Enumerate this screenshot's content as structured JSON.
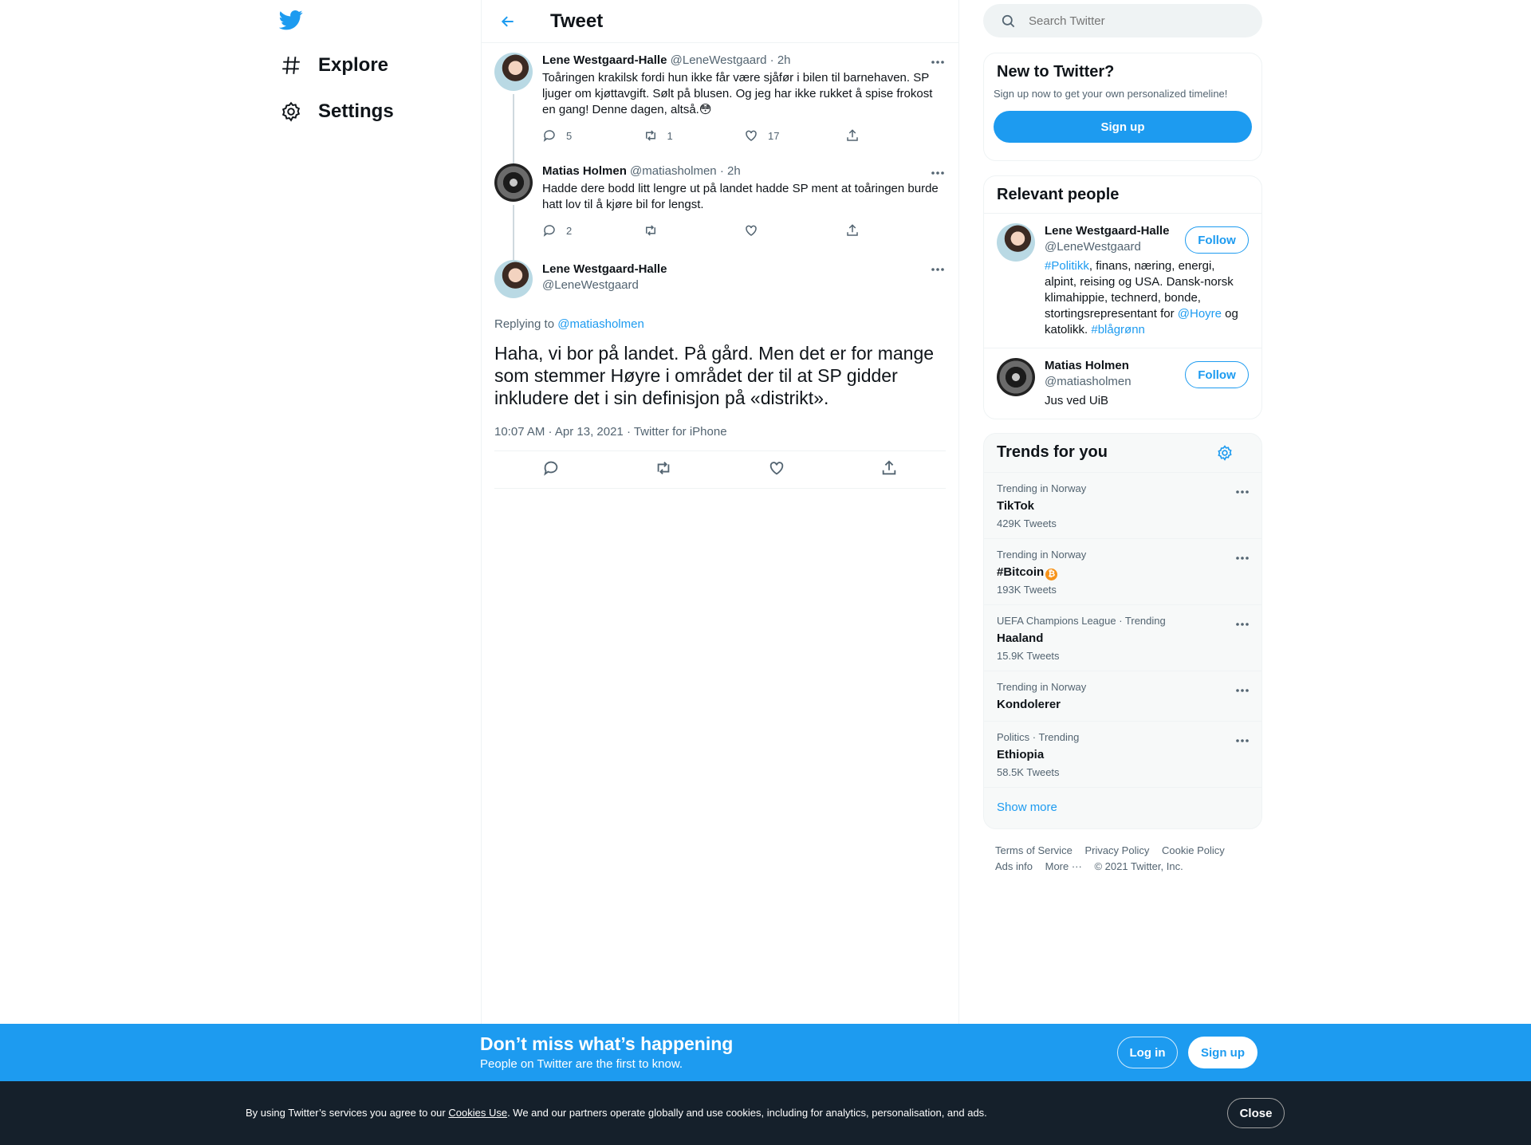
{
  "nav": {
    "explore_label": "Explore",
    "settings_label": "Settings"
  },
  "header": {
    "title": "Tweet"
  },
  "thread": [
    {
      "name": "Lene Westgaard-Halle",
      "handle": "@LeneWestgaard",
      "time": "· 2h",
      "text": "Toåringen krakilsk fordi hun ikke får være sjåfør i bilen til barnehaven. SP ljuger om kjøttavgift. Sølt på blusen. Og jeg har ikke rukket å spise frokost en gang! Denne dagen, altså.😳",
      "replies": "5",
      "retweets": "1",
      "likes": "17"
    },
    {
      "name": "Matias Holmen",
      "handle": "@matiasholmen",
      "time": "· 2h",
      "text": "Hadde dere bodd litt lengre ut på landet hadde SP ment at toåringen burde hatt lov til å kjøre bil for lengst.",
      "replies": "2",
      "retweets": "",
      "likes": ""
    }
  ],
  "focus": {
    "name": "Lene Westgaard-Halle",
    "handle": "@LeneWestgaard",
    "replying_prefix": "Replying to",
    "replying_handle": "@matiasholmen",
    "text": "Haha, vi bor på landet. På gård. Men det er for mange som stemmer Høyre i området der til at SP gidder inkludere det i sin definisjon på «distrikt».",
    "meta": "10:07 AM · Apr 13, 2021 · Twitter for iPhone"
  },
  "search": {
    "placeholder": "Search Twitter"
  },
  "new_to_twitter": {
    "title": "New to Twitter?",
    "subtitle": "Sign up now to get your own personalized timeline!",
    "signup_label": "Sign up"
  },
  "relevant_people": {
    "title": "Relevant people",
    "follow_label": "Follow",
    "people": [
      {
        "name": "Lene Westgaard-Halle",
        "handle": "@LeneWestgaard",
        "bio_tag1": "#Politikk",
        "bio_mid": ", finans, næring, energi, alpint, reising og USA. Dansk-norsk klimahippie, technerd, bonde, stortingsrepresentant for ",
        "bio_tag2": "@Hoyre",
        "bio_mid2": " og katolikk. ",
        "bio_tag3": "#blågrønn"
      },
      {
        "name": "Matias Holmen",
        "handle": "@matiasholmen",
        "bio": "Jus ved UiB"
      }
    ]
  },
  "trends": {
    "title": "Trends for you",
    "items": [
      {
        "context": "Trending in Norway",
        "name": "TikTok",
        "count": "429K Tweets"
      },
      {
        "context": "Trending in Norway",
        "name": "#Bitcoin",
        "emoji": "₿",
        "count": "193K Tweets"
      },
      {
        "context": "UEFA Champions League · Trending",
        "name": "Haaland",
        "count": "15.9K Tweets"
      },
      {
        "context": "Trending in Norway",
        "name": "Kondolerer",
        "count": ""
      },
      {
        "context": "Politics · Trending",
        "name": "Ethiopia",
        "count": "58.5K Tweets"
      }
    ],
    "show_more": "Show more"
  },
  "footer": {
    "terms": "Terms of Service",
    "privacy": "Privacy Policy",
    "cookie": "Cookie Policy",
    "ads": "Ads info",
    "more": "More ···",
    "copyright": "© 2021 Twitter, Inc."
  },
  "bottom_bar": {
    "title": "Don’t miss what’s happening",
    "subtitle": "People on Twitter are the first to know.",
    "login_label": "Log in",
    "signup_label": "Sign up"
  },
  "cookie_bar": {
    "text_before": "By using Twitter’s services you agree to our ",
    "link": "Cookies Use",
    "text_after": ". We and our partners operate globally and use cookies, including for analytics, personalisation, and ads.",
    "close_label": "Close"
  },
  "colors": {
    "accent": "#1d9bf0",
    "text": "#0f1419",
    "muted": "#536471",
    "cookie_bg": "#15202b"
  }
}
